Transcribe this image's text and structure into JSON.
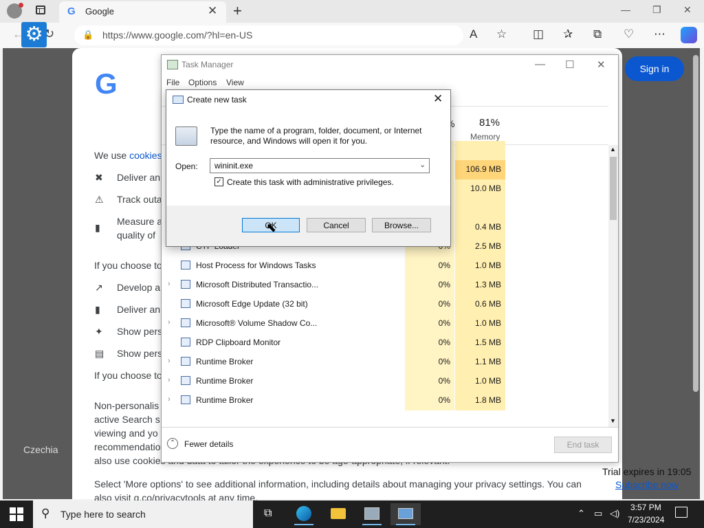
{
  "browser": {
    "tab_title": "Google",
    "tab_favicon": "G",
    "url": "https://www.google.com/?hl=en-US",
    "icons": [
      "profile-icon",
      "tab-actions-icon",
      "close-icon",
      "plus-icon",
      "back-icon",
      "settings-gear-icon",
      "refresh-icon",
      "lock-icon",
      "read-aloud-icon",
      "favorite-icon",
      "split-screen-icon",
      "favorites-icon",
      "collections-icon",
      "browser-essentials-icon",
      "more-icon",
      "copilot-icon"
    ]
  },
  "window_controls": {
    "minimize": "—",
    "maximize": "❐",
    "close": "✕"
  },
  "google": {
    "logo": "G",
    "sign_in": "Sign in",
    "line1_prefix": "We use ",
    "line1_link": "cookies",
    "items1": [
      "Deliver an",
      "Track outa",
      "Measure a",
      "quality of"
    ],
    "choose1": "If you choose to",
    "items2": [
      "Develop a",
      "Deliver an",
      "Show pers",
      "Show pers"
    ],
    "choose2": "If you choose to",
    "p1": [
      "Non-personalis",
      "active Search s",
      "viewing and yo",
      "recommendatio"
    ],
    "p1_last": "also use cookies and data to tailor the experience to be age-appropriate, if relevant.",
    "p2_line1": "Select 'More options' to see additional information, including details about managing your privacy settings. You can",
    "p2_line2": "also visit g.co/privacytools at any time.",
    "region": "Czechia"
  },
  "task_manager": {
    "title": "Task Manager",
    "menu": [
      "File",
      "Options",
      "View"
    ],
    "cpu_header_partial": "%",
    "memory_pct": "81%",
    "memory_label": "Memory",
    "window_controls": {
      "minimize": "—",
      "maximize": "☐",
      "close": "✕"
    },
    "rows": [
      {
        "name": "",
        "cpu": "%",
        "mem": "",
        "chev": false,
        "hidden_name": true
      },
      {
        "name": "",
        "cpu": "%",
        "mem": "106.9 MB",
        "chev": false,
        "hidden_name": true
      },
      {
        "name": "",
        "cpu": "%",
        "mem": "10.0 MB",
        "chev": false,
        "hidden_name": true
      },
      {
        "name": "",
        "cpu": "",
        "mem": "",
        "chev": false,
        "hidden_name": true
      },
      {
        "name": "AggregatorHost",
        "cpu": "0%",
        "mem": "0.4 MB",
        "chev": false
      },
      {
        "name": "CTF Loader",
        "cpu": "0%",
        "mem": "2.5 MB",
        "chev": false
      },
      {
        "name": "Host Process for Windows Tasks",
        "cpu": "0%",
        "mem": "1.0 MB",
        "chev": false
      },
      {
        "name": "Microsoft Distributed Transactio...",
        "cpu": "0%",
        "mem": "1.3 MB",
        "chev": true
      },
      {
        "name": "Microsoft Edge Update (32 bit)",
        "cpu": "0%",
        "mem": "0.6 MB",
        "chev": false
      },
      {
        "name": "Microsoft® Volume Shadow Co...",
        "cpu": "0%",
        "mem": "1.0 MB",
        "chev": true
      },
      {
        "name": "RDP Clipboard Monitor",
        "cpu": "0%",
        "mem": "1.5 MB",
        "chev": false
      },
      {
        "name": "Runtime Broker",
        "cpu": "0%",
        "mem": "1.1 MB",
        "chev": true
      },
      {
        "name": "Runtime Broker",
        "cpu": "0%",
        "mem": "1.0 MB",
        "chev": true
      },
      {
        "name": "Runtime Broker",
        "cpu": "0%",
        "mem": "1.8 MB",
        "chev": true
      }
    ],
    "fewer_details": "Fewer details",
    "end_task": "End task"
  },
  "dialog": {
    "title": "Create new task",
    "description": "Type the name of a program, folder, document, or Internet resource, and Windows will open it for you.",
    "open_label": "Open:",
    "open_value": "wininit.exe",
    "admin_label": "Create this task with administrative privileges.",
    "admin_checked": true,
    "ok": "OK",
    "cancel": "Cancel",
    "browse": "Browse..."
  },
  "trial": {
    "expires": "Trial expires in 19:05",
    "subscribe": "Subscribe now"
  },
  "taskbar": {
    "search_placeholder": "Type here to search",
    "time": "3:57 PM",
    "date": "7/23/2024",
    "apps": [
      "task-view-icon",
      "edge-icon",
      "file-explorer-icon",
      "task-manager-icon",
      "run-dialog-icon"
    ]
  }
}
